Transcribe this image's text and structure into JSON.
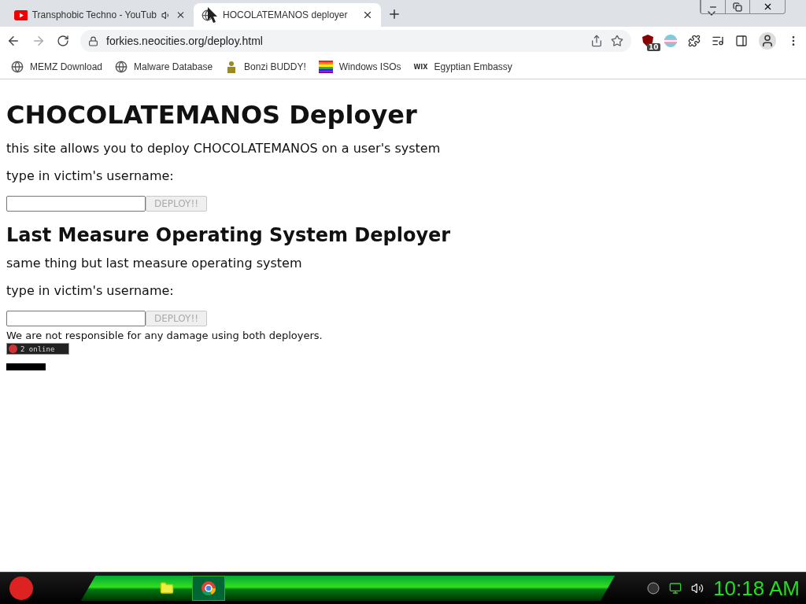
{
  "tabs": [
    {
      "title": "Transphobic Techno - YouTub",
      "kind": "video",
      "audio": true,
      "selected": false
    },
    {
      "title": "HOCOLATEMANOS deployer",
      "kind": "site",
      "audio": false,
      "selected": true
    }
  ],
  "address": {
    "url": "forkies.neocities.org/deploy.html"
  },
  "extension_badge": "10",
  "bookmarks": [
    {
      "label": "MEMZ Download",
      "kind": "globe"
    },
    {
      "label": "Malware Database",
      "kind": "globe"
    },
    {
      "label": "Bonzi BUDDY!",
      "kind": "figure"
    },
    {
      "label": "Windows ISOs",
      "kind": "rainbow"
    },
    {
      "label": "Egyptian Embassy",
      "kind": "wix",
      "icon_text": "WIX"
    }
  ],
  "page": {
    "sections": [
      {
        "heading": "CHOCOLATEMANOS Deployer",
        "kind": "main",
        "text": "this site allows you to deploy CHOCOLATEMANOS on a user's system",
        "prompt": "type in victim's username:",
        "button": "DEPLOY!!",
        "disabled": true
      },
      {
        "heading": "Last Measure Operating System Deployer",
        "kind": "sub",
        "text": "same thing but last measure operating system",
        "prompt": "type in victim's username:",
        "button": "DEPLOY!!",
        "disabled": true
      }
    ],
    "disclaimer": "We are not responsible for any damage using both deployers.",
    "online": "2 online"
  },
  "taskbar": {
    "clock": "10:18 AM"
  }
}
